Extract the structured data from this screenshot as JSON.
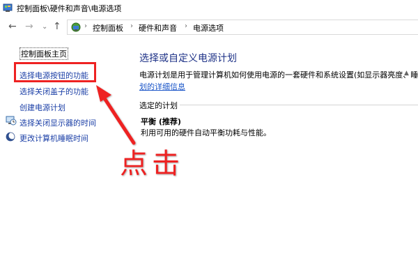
{
  "window": {
    "title": "控制面板\\硬件和声音\\电源选项",
    "icon": "control-panel-icon"
  },
  "navigation": {
    "back_icon": "arrow-left-icon",
    "forward_icon": "arrow-right-icon",
    "recent_icon": "chevron-down-icon",
    "up_icon": "arrow-up-icon",
    "separator": "›",
    "breadcrumbs": [
      "控制面板",
      "硬件和声音",
      "电源选项"
    ]
  },
  "sidebar": {
    "home": "控制面板主页",
    "items": [
      {
        "label": "选择电源按钮的功能",
        "icon": ""
      },
      {
        "label": "选择关闭盖子的功能",
        "icon": ""
      },
      {
        "label": "创建电源计划",
        "icon": ""
      },
      {
        "label": "选择关闭显示器的时间",
        "icon": "display-clock-icon"
      },
      {
        "label": "更改计算机睡眠时间",
        "icon": "moon-icon"
      }
    ]
  },
  "main": {
    "title": "选择或自定义电源计划",
    "description": "电源计划是用于管理计算机如何使用电源的一套硬件和系统设置(如显示器亮度、睡眠",
    "detail_link": "划的详细信息",
    "section_label": "选定的计划",
    "plan": {
      "name": "平衡 (推荐)",
      "description": "利用可用的硬件自动平衡功耗与性能。"
    }
  },
  "annotation": {
    "text": "点击",
    "color": "#ee2222"
  },
  "colors": {
    "link": "#1a3ea6",
    "title": "#1e3287",
    "highlight": "#ee2222"
  }
}
